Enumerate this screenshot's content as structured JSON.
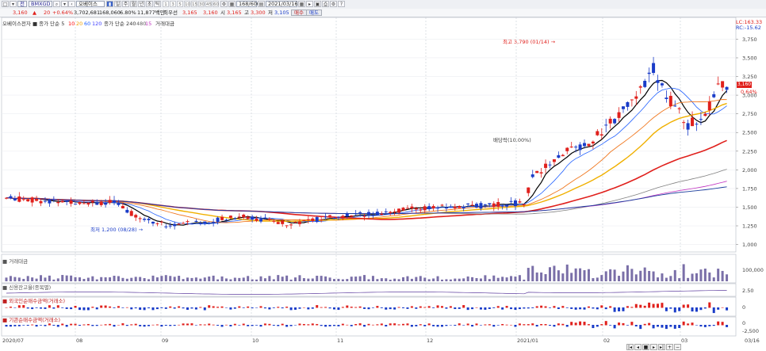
{
  "toolbar": {
    "stock_code": "BMXGD",
    "stock_name": "오베이스",
    "periods": [
      "1",
      "3",
      "5",
      "10",
      "15",
      "30",
      "45",
      "60"
    ],
    "count": "168/600",
    "date": "2021/03/16"
  },
  "quote": {
    "price": "3,160",
    "change": "20",
    "change_pct": "+0.64%",
    "volume": "3,702,681",
    "vol2": "168,060",
    "ratio": "6.80%",
    "amount": "11,877백만",
    "bid_label": "최우선",
    "bid": "3,165",
    "ask": "3,160",
    "high_label": "시",
    "open": "3,165",
    "high_lbl2": "고",
    "high": "3,300",
    "low_lbl": "저",
    "low": "3,105",
    "buy_btn": "매수",
    "sell_btn": "매도"
  },
  "legend": {
    "main": "오베이스전자 ■ 종가 단순 5",
    "ma_values": [
      "10",
      "20",
      "60",
      "120"
    ],
    "ma_colors": [
      "#ff0000",
      "#f0a000",
      "#2060ff",
      "#4040ff"
    ],
    "ma2": "종가 단순 240",
    "ma2_values": [
      "480",
      "15"
    ],
    "amount_label": "거래대금"
  },
  "right_top": {
    "line1": "LC:163.33",
    "line2": "RC:-15.62"
  },
  "price_badge": "3,160",
  "price_badge2": "0.64%",
  "annotations": {
    "high": "최고 3,790 (01/14) →",
    "low": "최저 1,200 (08/28) →",
    "mark": "배당락(10.00%)"
  },
  "subpanels": {
    "p1": "■ 거래대금",
    "p2": "■ 신용잔고율(종목별)",
    "p3": "■ 외국인순매수금액(거래소)",
    "p4": "■ 기관순매수금액(거래소)"
  },
  "chart_data": {
    "type": "candlestick",
    "price_axis": [
      "3,750",
      "3,500",
      "3,250",
      "3,000",
      "2,750",
      "2,500",
      "2,250",
      "2,000",
      "1,750",
      "1,500",
      "1,250",
      "1,000"
    ],
    "x_labels": [
      "2020/07",
      "08",
      "09",
      "10",
      "11",
      "12",
      "2021/01",
      "02",
      "03",
      "03/16"
    ],
    "vol_axis": [
      "100,000"
    ],
    "credit_axis": [
      "2.50"
    ],
    "foreign_axis": [
      "0"
    ],
    "inst_axis": [
      "0",
      "-2,500"
    ],
    "high": 3790,
    "low": 1200,
    "last": 3160
  }
}
